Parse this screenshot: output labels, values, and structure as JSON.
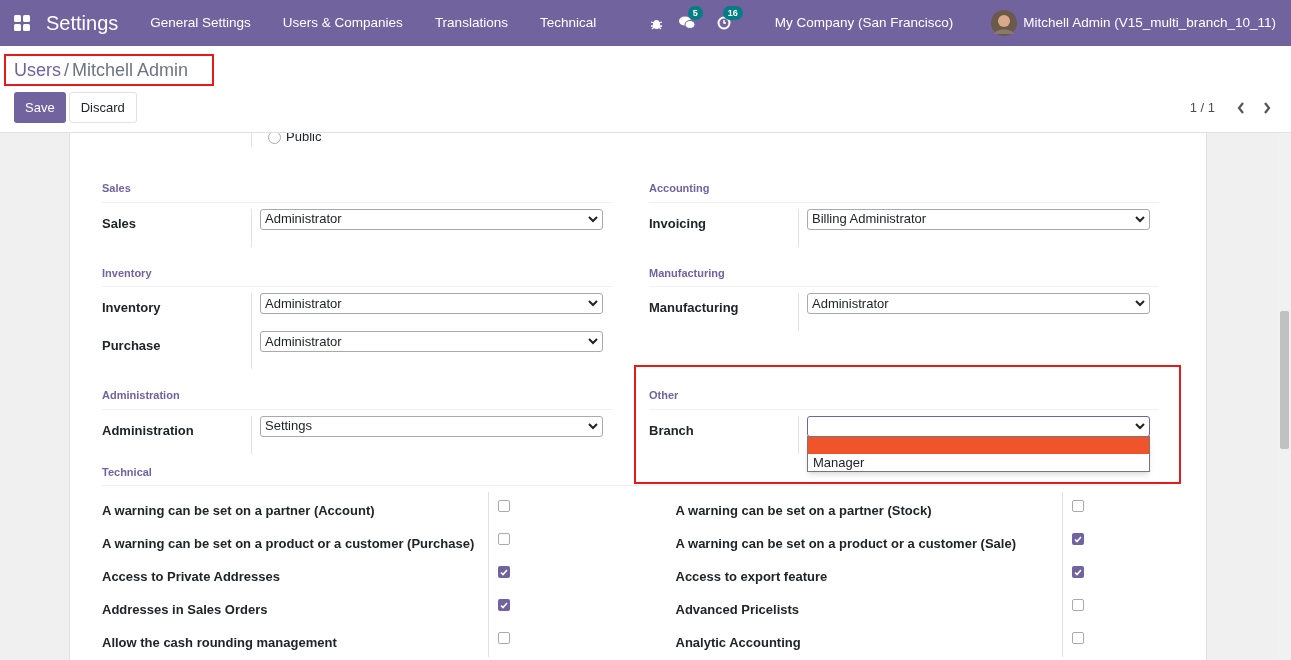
{
  "navbar": {
    "app_title": "Settings",
    "menus": [
      "General Settings",
      "Users & Companies",
      "Translations",
      "Technical"
    ],
    "messages_count": "5",
    "activities_count": "16",
    "company": "My Company (San Francisco)",
    "user": "Mitchell Admin (V15_multi_branch_10_11)"
  },
  "breadcrumb": {
    "parent": "Users",
    "separator": "/",
    "current": "Mitchell Admin"
  },
  "buttons": [
    "Save",
    "Discard"
  ],
  "pager": "1 / 1",
  "partial_option": {
    "label": "Public",
    "selected": false
  },
  "groups": [
    {
      "title": "Sales",
      "fields": [
        {
          "label": "Sales",
          "value": "Administrator"
        }
      ]
    },
    {
      "title": "Accounting",
      "fields": [
        {
          "label": "Invoicing",
          "value": "Billing Administrator"
        }
      ]
    },
    {
      "title": "Inventory",
      "fields": [
        {
          "label": "Inventory",
          "value": "Administrator"
        },
        {
          "label": "Purchase",
          "value": "Administrator"
        }
      ]
    },
    {
      "title": "Manufacturing",
      "fields": [
        {
          "label": "Manufacturing",
          "value": "Administrator"
        }
      ]
    },
    {
      "title": "Administration",
      "fields": [
        {
          "label": "Administration",
          "value": "Settings"
        }
      ]
    },
    {
      "title": "Other",
      "fields": [
        {
          "label": "Branch",
          "expanded": true,
          "options": [
            {
              "selected": true
            },
            {
              "label": "Manager",
              "selected": false
            }
          ]
        }
      ]
    }
  ],
  "technical": {
    "title": "Technical",
    "rows": [
      {
        "label": "A warning can be set on a partner (Account)",
        "checked": false
      },
      {
        "label": "A warning can be set on a partner (Stock)",
        "checked": false
      },
      {
        "label": "A warning can be set on a product or a customer (Purchase)",
        "checked": false
      },
      {
        "label": "A warning can be set on a product or a customer (Sale)",
        "checked": true
      },
      {
        "label": "Access to Private Addresses",
        "checked": true
      },
      {
        "label": "Access to export feature",
        "checked": true
      },
      {
        "label": "Addresses in Sales Orders",
        "checked": true
      },
      {
        "label": "Advanced Pricelists",
        "checked": false
      },
      {
        "label": "Allow the cash rounding management",
        "checked": false
      },
      {
        "label": "Analytic Accounting",
        "checked": false
      }
    ]
  }
}
